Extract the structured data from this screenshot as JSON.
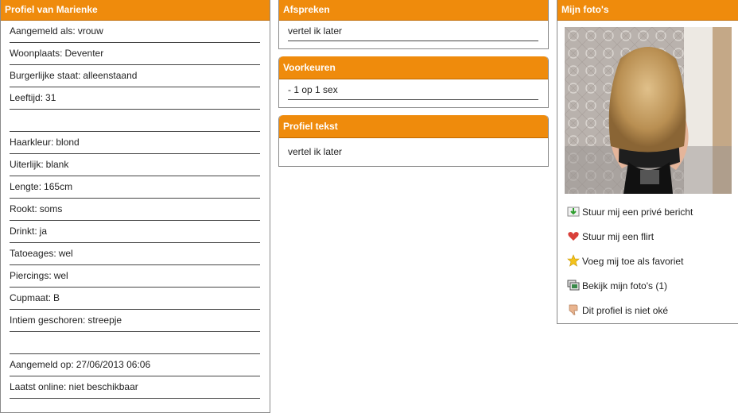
{
  "profile": {
    "title": "Profiel van Marienke",
    "rows": [
      {
        "label": "Aangemeld als:",
        "value": "vrouw"
      },
      {
        "label": "Woonplaats:",
        "value": "Deventer"
      },
      {
        "label": "Burgerlijke staat:",
        "value": "alleenstaand"
      },
      {
        "label": "Leeftijd:",
        "value": "31"
      },
      {
        "label": "",
        "value": ""
      },
      {
        "label": "Haarkleur:",
        "value": "blond"
      },
      {
        "label": "Uiterlijk:",
        "value": "blank"
      },
      {
        "label": "Lengte:",
        "value": "165cm"
      },
      {
        "label": "Rookt:",
        "value": "soms"
      },
      {
        "label": "Drinkt:",
        "value": "ja"
      },
      {
        "label": "Tatoeages:",
        "value": "wel"
      },
      {
        "label": "Piercings:",
        "value": "wel"
      },
      {
        "label": "Cupmaat:",
        "value": "B"
      },
      {
        "label": "Intiem geschoren:",
        "value": "streepje"
      },
      {
        "label": "",
        "value": ""
      },
      {
        "label": "Aangemeld op:",
        "value": "27/06/2013 06:06"
      },
      {
        "label": "Laatst online:",
        "value": "niet beschikbaar"
      }
    ]
  },
  "afspreken": {
    "title": "Afspreken",
    "value": "vertel ik later"
  },
  "voorkeuren": {
    "title": "Voorkeuren",
    "value": "- 1 op 1 sex"
  },
  "profieltekst": {
    "title": "Profiel tekst",
    "value": "vertel ik later"
  },
  "photos": {
    "title": "Mijn foto's",
    "actions": [
      {
        "label": "Stuur mij een privé bericht",
        "icon": "message-icon"
      },
      {
        "label": "Stuur mij een flirt",
        "icon": "heart-icon"
      },
      {
        "label": "Voeg mij toe als favoriet",
        "icon": "star-icon"
      },
      {
        "label": "Bekijk mijn foto's (1)",
        "icon": "photos-icon"
      },
      {
        "label": "Dit profiel is niet oké",
        "icon": "thumbs-down-icon"
      }
    ]
  },
  "colors": {
    "header": "#ef8b0c",
    "border": "#8a8a8a"
  }
}
